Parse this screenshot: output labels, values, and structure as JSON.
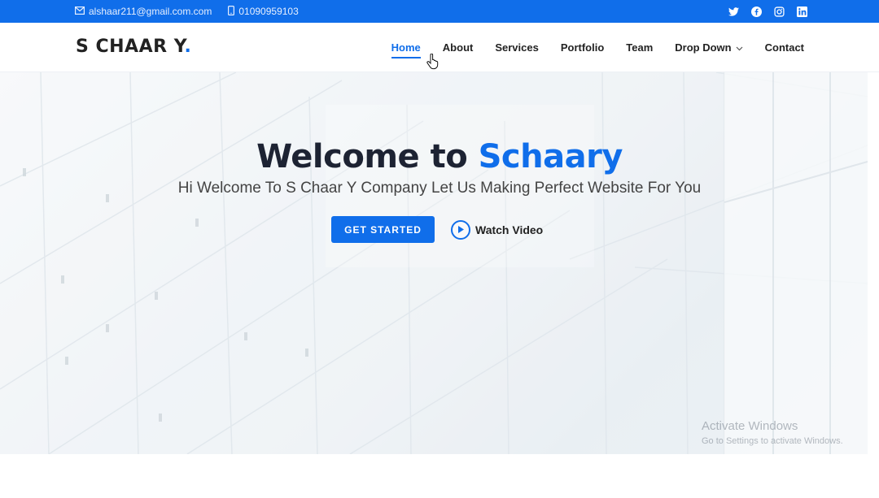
{
  "topbar": {
    "email": "alshaar211@gmail.com.com",
    "phone": "01090959103",
    "socials": [
      "twitter-icon",
      "facebook-icon",
      "instagram-icon",
      "linkedin-icon"
    ],
    "background": "#106eea"
  },
  "header": {
    "logo_text": "S CHAAR Y",
    "logo_dot": ".",
    "nav": [
      {
        "label": "Home",
        "active": true
      },
      {
        "label": "About"
      },
      {
        "label": "Services"
      },
      {
        "label": "Portfolio"
      },
      {
        "label": "Team"
      },
      {
        "label": "Drop Down",
        "has_dropdown": true
      },
      {
        "label": "Contact"
      }
    ]
  },
  "hero": {
    "title_prefix": "Welcome to",
    "title_accent": "Schaary",
    "subtitle": "Hi Welcome To S Chaar Y Company Let Us Making Perfect Website For You",
    "cta_label": "GET STARTED",
    "video_label": "Watch Video"
  },
  "watermark": {
    "line1": "Activate Windows",
    "line2": "Go to Settings to activate Windows."
  },
  "colors": {
    "accent": "#106eea",
    "title": "#1d2333"
  }
}
